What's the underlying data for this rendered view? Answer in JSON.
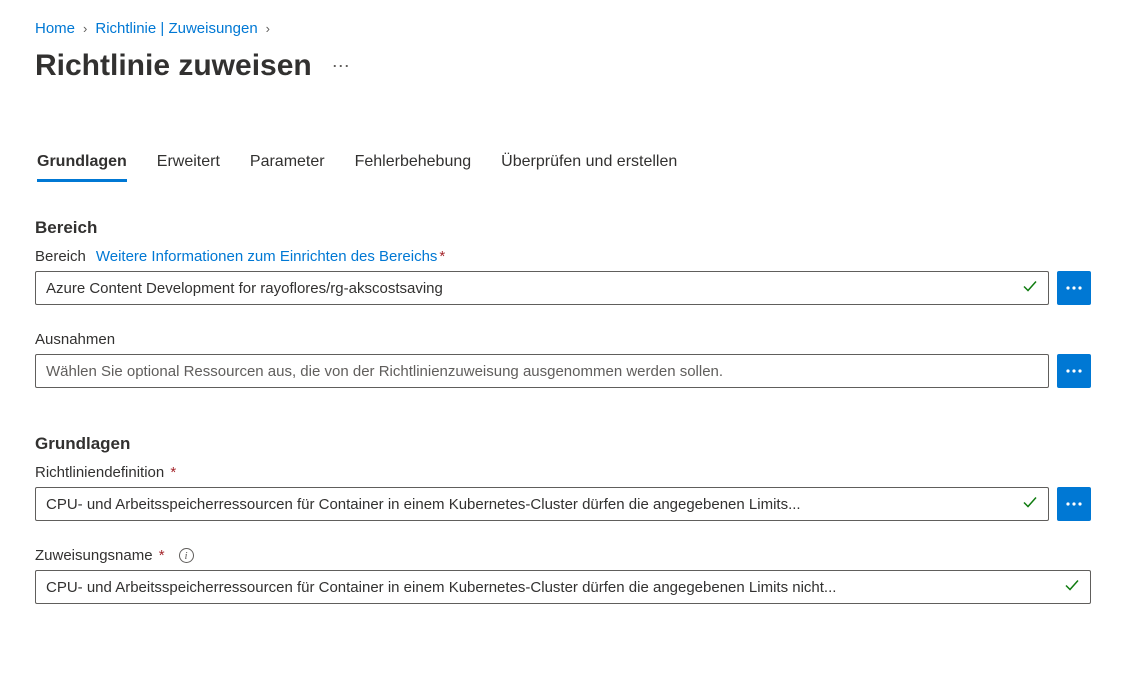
{
  "breadcrumb": {
    "home": "Home",
    "policy_assignments": "Richtlinie | Zuweisungen"
  },
  "page_title": "Richtlinie zuweisen",
  "tabs": {
    "basics": "Grundlagen",
    "advanced": "Erweitert",
    "parameters": "Parameter",
    "remediation": "Fehlerbehebung",
    "review_create": "Überprüfen und erstellen"
  },
  "sections": {
    "scope_heading": "Bereich",
    "basics_heading": "Grundlagen"
  },
  "scope": {
    "label": "Bereich",
    "help_link": "Weitere Informationen zum Einrichten des Bereichs",
    "value": "Azure Content Development for rayoflores/rg-akscostsaving"
  },
  "exclusions": {
    "label": "Ausnahmen",
    "placeholder": "Wählen Sie optional Ressourcen aus, die von der Richtlinienzuweisung ausgenommen werden sollen."
  },
  "policy_definition": {
    "label": "Richtliniendefinition",
    "value": "CPU- und Arbeitsspeicherressourcen für Container in einem Kubernetes-Cluster dürfen die angegebenen Limits..."
  },
  "assignment_name": {
    "label": "Zuweisungsname",
    "value": "CPU- und Arbeitsspeicherressourcen für Container in einem Kubernetes-Cluster dürfen die angegebenen Limits nicht..."
  }
}
